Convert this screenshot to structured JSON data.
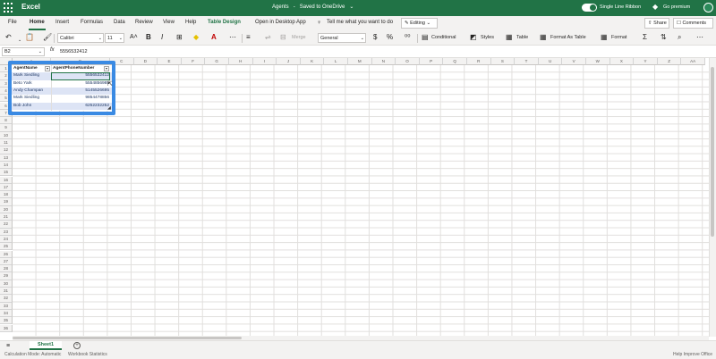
{
  "title_bar": {
    "app_name": "Excel",
    "doc_name": "Agents",
    "save_status": "Saved to OneDrive",
    "save_caret": "⌄",
    "single_line_ribbon": "Single Line Ribbon",
    "go_premium": "Go premium",
    "avatar_initials": ""
  },
  "tabs": [
    "File",
    "Home",
    "Insert",
    "Formulas",
    "Data",
    "Review",
    "View",
    "Help",
    "Table Design",
    "Open in Desktop App"
  ],
  "tell_me": "Tell me what you want to do",
  "editing_label": "✎ Editing ⌄",
  "share_label": "⇧ Share",
  "comments_label": "☐ Comments",
  "ribbon": {
    "font_name": "Calibri",
    "font_size": "11",
    "merge": "Merge",
    "number_format": "General",
    "conditional": "Conditional",
    "styles": "Styles",
    "table": "Table",
    "format_as_table": "Format As Table",
    "format": "Format"
  },
  "formula_bar": {
    "name_box": "B2",
    "fx": "fx",
    "value": "5556532412"
  },
  "columns": [
    "A",
    "B",
    "C",
    "D",
    "E",
    "F",
    "G",
    "H",
    "I",
    "J",
    "K",
    "L",
    "M",
    "N",
    "O",
    "P",
    "Q",
    "R",
    "S",
    "T",
    "U",
    "V",
    "W",
    "X",
    "Y",
    "Z",
    "AA"
  ],
  "rows": [
    "1",
    "2",
    "3",
    "4",
    "5",
    "6",
    "7",
    "8",
    "9",
    "10",
    "11",
    "12",
    "13",
    "14",
    "15",
    "16",
    "17",
    "18",
    "19",
    "20",
    "21",
    "22",
    "23",
    "24",
    "25",
    "26",
    "27",
    "28",
    "29",
    "30",
    "31",
    "32",
    "33",
    "34",
    "35",
    "36"
  ],
  "table": {
    "headers": [
      "AgentName",
      "AgentPhoneNumber"
    ],
    "rows": [
      {
        "name": "Mark Siedling",
        "phone": "5556532412"
      },
      {
        "name": "Beto Yark",
        "phone": "5554856985"
      },
      {
        "name": "Andy Champan",
        "phone": "5145526695"
      },
      {
        "name": "Mark Siedling",
        "phone": "9854478856"
      },
      {
        "name": "Bob John",
        "phone": "6252232252"
      }
    ]
  },
  "sheet_tab": "Sheet1",
  "status": {
    "calc_mode": "Calculation Mode: Automatic",
    "workbook_stats": "Workbook Statistics",
    "help_improve": "Help Improve Office"
  },
  "colors": {
    "brand_green": "#217346",
    "table_band": "#dde4f5",
    "highlight_blue": "#3a8ae3"
  }
}
